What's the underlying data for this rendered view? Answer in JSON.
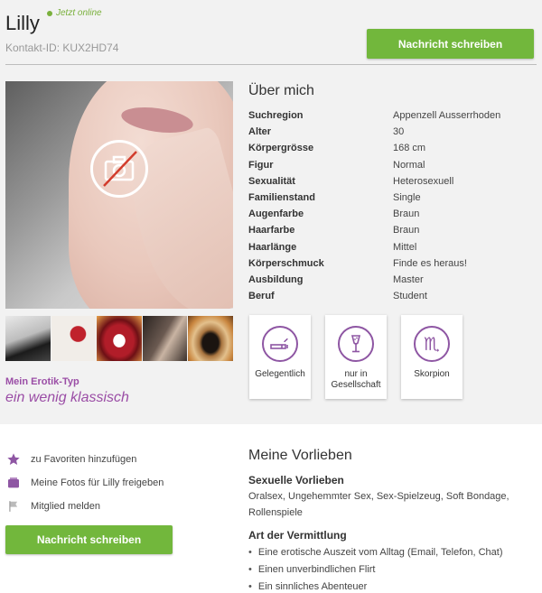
{
  "profile": {
    "name": "Lilly",
    "online_status": "Jetzt online",
    "contact_id": "Kontakt-ID: KUX2HD74",
    "message_button": "Nachricht schreiben"
  },
  "photo": {
    "icon": "camera-off-icon",
    "thumbnails": [
      "thumb-1",
      "thumb-2",
      "thumb-3",
      "thumb-4",
      "thumb-5"
    ]
  },
  "erotik": {
    "label": "Mein Erotik-Typ",
    "value": "ein wenig klassisch"
  },
  "about": {
    "title": "Über mich",
    "rows": [
      {
        "key": "Suchregion",
        "value": "Appenzell Ausserrhoden"
      },
      {
        "key": "Alter",
        "value": "30"
      },
      {
        "key": "Körpergrösse",
        "value": "168 cm"
      },
      {
        "key": "Figur",
        "value": "Normal"
      },
      {
        "key": "Sexualität",
        "value": "Heterosexuell"
      },
      {
        "key": "Familienstand",
        "value": "Single"
      },
      {
        "key": "Augenfarbe",
        "value": "Braun"
      },
      {
        "key": "Haarfarbe",
        "value": "Braun"
      },
      {
        "key": "Haarlänge",
        "value": "Mittel"
      },
      {
        "key": "Körperschmuck",
        "value": "Finde es heraus!"
      },
      {
        "key": "Ausbildung",
        "value": "Master"
      },
      {
        "key": "Beruf",
        "value": "Student"
      }
    ]
  },
  "cards": [
    {
      "icon": "cigarette-icon",
      "label": "Gelegentlich"
    },
    {
      "icon": "champagne-glass-icon",
      "label": "nur in Gesellschaft"
    },
    {
      "icon": "scorpio-icon",
      "label": "Skorpion",
      "glyph": "♏"
    }
  ],
  "actions": {
    "favorites": "zu Favoriten hinzufügen",
    "share_photos": "Meine Fotos für Lilly freigeben",
    "report": "Mitglied melden",
    "message_button": "Nachricht schreiben"
  },
  "preferences": {
    "title": "Meine Vorlieben",
    "sexual_title": "Sexuelle Vorlieben",
    "sexual_text": "Oralsex, Ungehemmter Sex, Sex-Spielzeug, Soft Bondage, Rollenspiele",
    "mediation_title": "Art der Vermittlung",
    "mediation_items": [
      "Eine erotische Auszeit vom Alltag (Email, Telefon, Chat)",
      "Einen unverbindlichen Flirt",
      "Ein sinnliches Abenteuer"
    ]
  },
  "colors": {
    "accent_green": "#72b73c",
    "accent_purple": "#9b4ea6",
    "online_green": "#7ab03c"
  }
}
